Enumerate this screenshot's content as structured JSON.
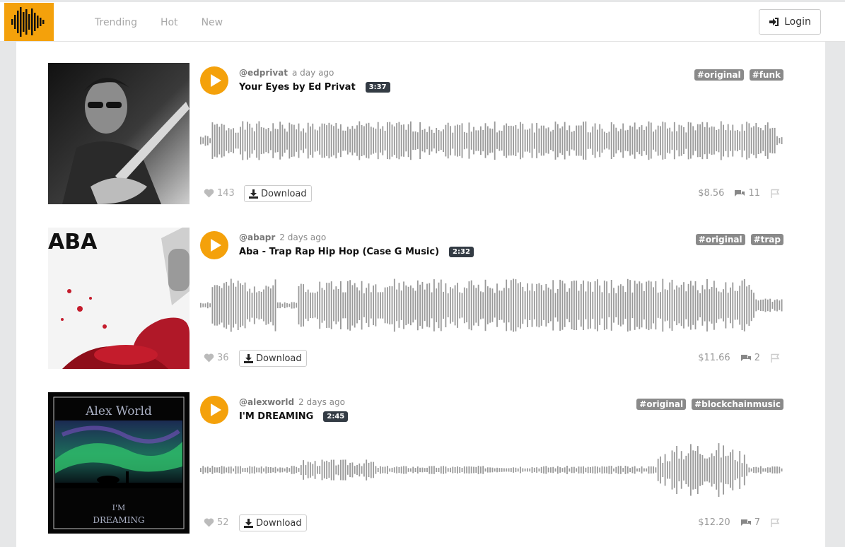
{
  "nav": {
    "tabs": [
      "Trending",
      "Hot",
      "New"
    ]
  },
  "header": {
    "login_label": "Login"
  },
  "colors": {
    "accent": "#f4a10b",
    "tag_bg": "#8a8a8a",
    "duration_bg": "#333b44",
    "wave": "#999999"
  },
  "tracks": [
    {
      "author": "@edprivat",
      "ago": "a day ago",
      "title": "Your Eyes by Ed Privat",
      "duration": "3:37",
      "tags": [
        "#original",
        "#funk"
      ],
      "likes": "143",
      "download_label": "Download",
      "payout": "$8.56",
      "comments": "11"
    },
    {
      "author": "@abapr",
      "ago": "2 days ago",
      "title": "Aba - Trap Rap Hip Hop (Case G Music)",
      "duration": "2:32",
      "tags": [
        "#original",
        "#trap"
      ],
      "likes": "36",
      "download_label": "Download",
      "payout": "$11.66",
      "comments": "2",
      "cover_text": "ABA"
    },
    {
      "author": "@alexworld",
      "ago": "2 days ago",
      "title": "I'M DREAMING",
      "duration": "2:45",
      "tags": [
        "#original",
        "#blockchainmusic"
      ],
      "likes": "52",
      "download_label": "Download",
      "payout": "$12.20",
      "comments": "7",
      "cover_text": "Alex World",
      "cover_subtext_1": "I'M",
      "cover_subtext_2": "DREAMING"
    }
  ]
}
